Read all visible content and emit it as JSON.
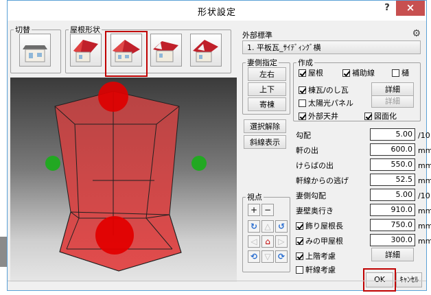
{
  "window": {
    "title": "形状設定",
    "help_label": "?",
    "close_label": "×"
  },
  "switch_group": {
    "label": "切替",
    "thumb_icon": "house-thumbnail-icon"
  },
  "roof_group": {
    "label": "屋根形状",
    "options": [
      {
        "name": "gable-roof-icon"
      },
      {
        "name": "hip-roof-icon"
      },
      {
        "name": "hip-gable-roof-icon"
      },
      {
        "name": "half-hip-roof-icon"
      }
    ],
    "selected_index": 1
  },
  "exterior": {
    "label": "外部標準",
    "standard_value": "1. 平板瓦_ｻｲﾃﾞｨﾝｸﾞ横",
    "gear_icon": "gear-icon"
  },
  "gable_spec": {
    "label": "妻側指定",
    "buttons": [
      "左右",
      "上下",
      "寄棟"
    ]
  },
  "creation": {
    "label": "作成",
    "items": [
      {
        "label": "屋根",
        "checked": true
      },
      {
        "label": "補助線",
        "checked": true
      },
      {
        "label": "樋",
        "checked": false
      },
      {
        "label": "棟瓦/のし瓦",
        "checked": true
      },
      {
        "label": "太陽光パネル",
        "checked": false
      },
      {
        "label": "外部天井",
        "checked": true
      },
      {
        "label": "図面化",
        "checked": true
      }
    ],
    "detail_label": "詳細",
    "detail_disabled_label": "詳細"
  },
  "actions": {
    "deselect_label": "選択解除",
    "slope_line_label": "斜線表示"
  },
  "params": [
    {
      "label": "勾配",
      "value": "5.00",
      "unit": "/10"
    },
    {
      "label": "軒の出",
      "value": "600.0",
      "unit": "mm"
    },
    {
      "label": "けらばの出",
      "value": "550.0",
      "unit": "mm"
    },
    {
      "label": "軒線からの逃げ",
      "value": "52.5",
      "unit": "mm"
    },
    {
      "label": "妻側勾配",
      "value": "5.00",
      "unit": "/10"
    },
    {
      "label": "妻壁奥行き",
      "value": "910.0",
      "unit": "mm"
    },
    {
      "label": "飾り屋根長",
      "value": "750.0",
      "unit": "mm",
      "checked": true
    },
    {
      "label": "みの甲屋根",
      "value": "300.0",
      "unit": "mm",
      "checked": true
    }
  ],
  "upper_floor": {
    "label": "上階考慮",
    "checked": true,
    "detail_label": "詳細"
  },
  "eave_line": {
    "label": "軒線考慮",
    "checked": false
  },
  "viewpoint": {
    "label": "視点",
    "zoom_in": "+",
    "zoom_out": "−",
    "rotate_left": "↻",
    "up": "△",
    "rotate_right": "↺",
    "left": "◁",
    "home": "⌂",
    "right": "▷",
    "rotate_ccw": "⟲",
    "down": "▽",
    "rotate_cw": "⟳"
  },
  "footer": {
    "ok_label": "OK",
    "cancel_label": "ｷｬﾝｾﾙ"
  }
}
